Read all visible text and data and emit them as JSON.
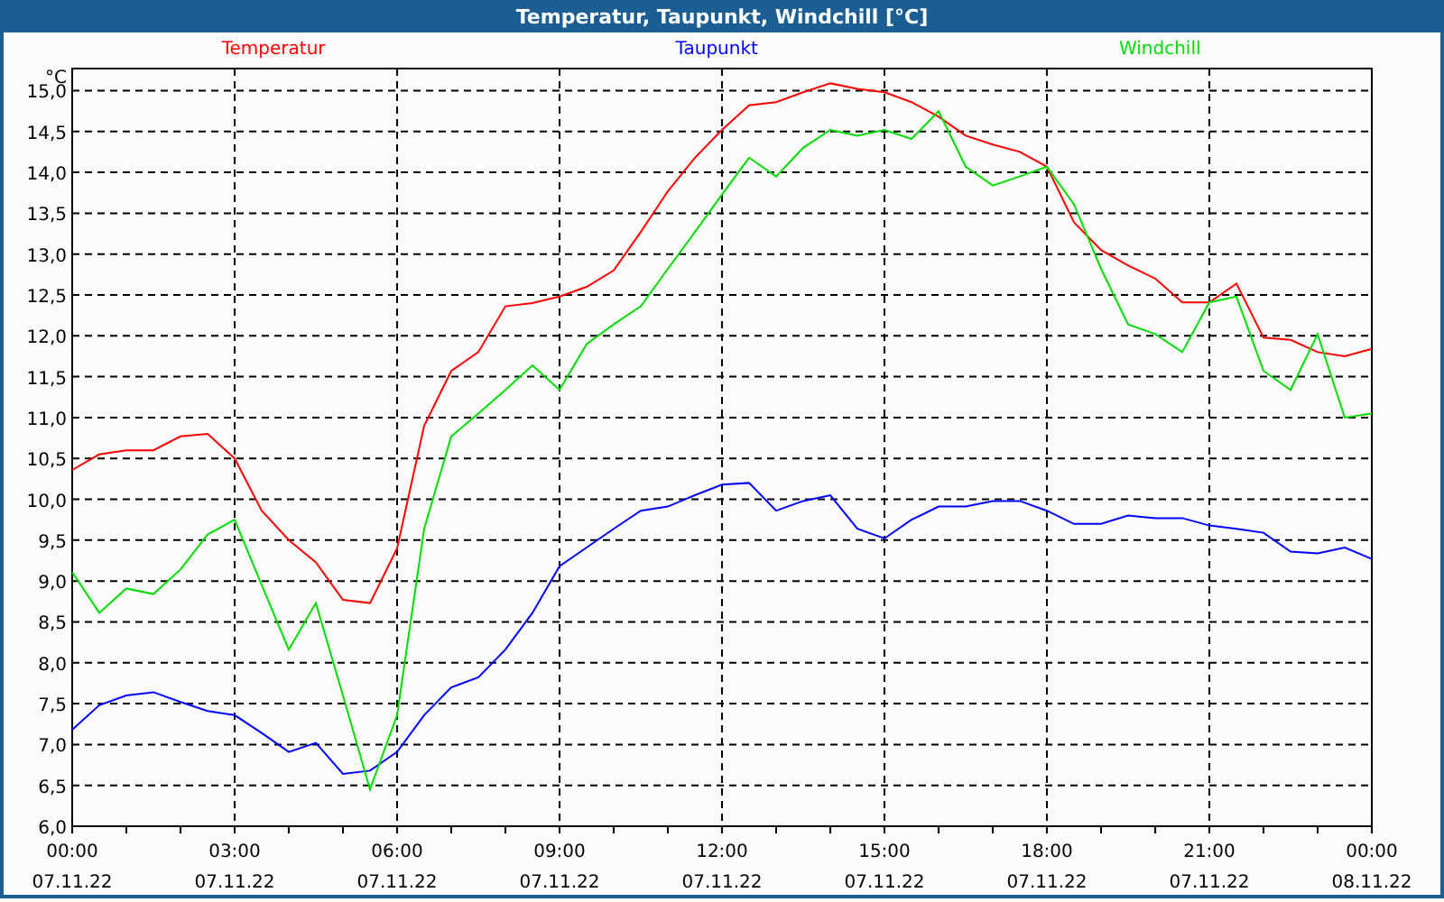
{
  "window": {
    "title": "Temperatur, Taupunkt, Windchill [°C]"
  },
  "chart": {
    "chart_data": {
      "type": "line",
      "ylabel": "°C",
      "categories": [
        "00:00\n07.11.22",
        null,
        null,
        null,
        null,
        null,
        "03:00\n07.11.22",
        null,
        null,
        null,
        null,
        null,
        "06:00\n07.11.22",
        null,
        null,
        null,
        null,
        null,
        "09:00\n07.11.22",
        null,
        null,
        null,
        null,
        null,
        "12:00\n07.11.22",
        null,
        null,
        null,
        null,
        null,
        "15:00\n07.11.22",
        null,
        null,
        null,
        null,
        null,
        "18:00\n07.11.22",
        null,
        null,
        null,
        null,
        null,
        "21:00\n07.11.22",
        null,
        null,
        null,
        null,
        null,
        "00:00\n08.11.22"
      ],
      "series": [
        {
          "name": "Temperatur",
          "color": "#ff0000",
          "values": [
            10.36,
            10.55,
            10.6,
            10.6,
            10.77,
            10.8,
            10.5,
            9.86,
            9.5,
            9.23,
            8.77,
            8.73,
            9.4,
            10.9,
            11.57,
            11.8,
            12.36,
            12.4,
            12.48,
            12.6,
            12.8,
            13.27,
            13.77,
            14.18,
            14.52,
            14.82,
            14.86,
            14.98,
            15.09,
            15.02,
            14.98,
            14.86,
            14.68,
            14.45,
            14.34,
            14.25,
            14.07,
            13.39,
            13.05,
            12.86,
            12.7,
            12.41,
            12.41,
            12.64,
            11.98,
            11.95,
            11.8,
            11.75,
            11.84
          ]
        },
        {
          "name": "Taupunkt",
          "color": "#0000ff",
          "values": [
            7.18,
            7.48,
            7.6,
            7.64,
            7.52,
            7.41,
            7.36,
            7.14,
            6.91,
            7.02,
            6.64,
            6.68,
            6.91,
            7.36,
            7.7,
            7.82,
            8.16,
            8.61,
            9.18,
            9.41,
            9.64,
            9.86,
            9.91,
            10.05,
            10.18,
            10.2,
            9.86,
            9.98,
            10.05,
            9.64,
            9.52,
            9.75,
            9.91,
            9.91,
            9.98,
            9.98,
            9.86,
            9.7,
            9.7,
            9.8,
            9.77,
            9.77,
            9.68,
            9.64,
            9.59,
            9.36,
            9.34,
            9.41,
            9.27
          ]
        },
        {
          "name": "Windchill",
          "color": "#00dd00",
          "values": [
            9.11,
            8.61,
            8.91,
            8.84,
            9.14,
            9.57,
            9.75,
            8.95,
            8.16,
            8.73,
            7.6,
            6.45,
            7.36,
            9.64,
            10.77,
            11.05,
            11.34,
            11.64,
            11.34,
            11.9,
            12.14,
            12.36,
            12.82,
            13.27,
            13.73,
            14.18,
            13.95,
            14.3,
            14.52,
            14.45,
            14.52,
            14.41,
            14.75,
            14.07,
            13.84,
            13.95,
            14.07,
            13.61,
            12.82,
            12.14,
            12.02,
            11.8,
            12.41,
            12.48,
            11.57,
            11.34,
            12.02,
            11.0,
            11.05
          ]
        }
      ],
      "ylim": [
        6,
        15.27
      ],
      "grid": true,
      "yticks": [
        {
          "value": 6,
          "label": "6,0"
        },
        {
          "value": 6.5,
          "label": "6,5"
        },
        {
          "value": 7,
          "label": "7,0"
        },
        {
          "value": 7.5,
          "label": "7,5"
        },
        {
          "value": 8,
          "label": "8,0"
        },
        {
          "value": 8.5,
          "label": "8,5"
        },
        {
          "value": 9,
          "label": "9,0"
        },
        {
          "value": 9.5,
          "label": "9,5"
        },
        {
          "value": 10,
          "label": "10,0"
        },
        {
          "value": 10.5,
          "label": "10,5"
        },
        {
          "value": 11,
          "label": "11,0"
        },
        {
          "value": 11.5,
          "label": "11,5"
        },
        {
          "value": 12,
          "label": "12,0"
        },
        {
          "value": 12.5,
          "label": "12,5"
        },
        {
          "value": 13,
          "label": "13,0"
        },
        {
          "value": 13.5,
          "label": "13,5"
        },
        {
          "value": 14,
          "label": "14,0"
        },
        {
          "value": 14.5,
          "label": "14,5"
        },
        {
          "value": 15,
          "label": "15,0"
        }
      ]
    }
  }
}
